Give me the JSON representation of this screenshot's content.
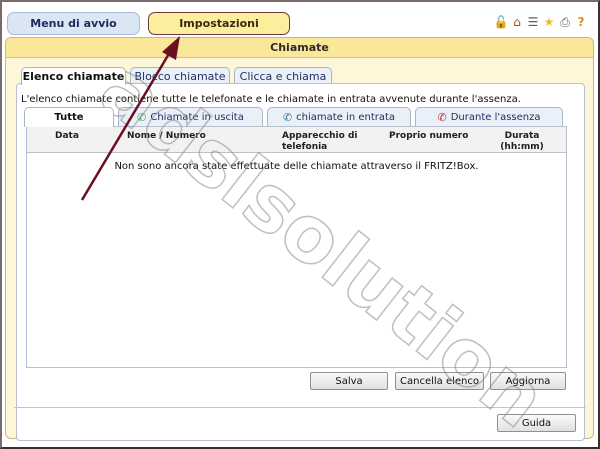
{
  "nav": {
    "start_menu_label": "Menu di avvio",
    "settings_label": "Impostazioni"
  },
  "toolbar_icons": [
    "lock-icon",
    "home-icon",
    "sitemap-icon",
    "star-icon",
    "print-icon",
    "help-icon"
  ],
  "panel": {
    "title": "Chiamate"
  },
  "tabs": [
    {
      "label": "Elenco chiamate",
      "active": true
    },
    {
      "label": "Blocco chiamate",
      "active": false
    },
    {
      "label": "Clicca e chiama",
      "active": false
    }
  ],
  "description": "L'elenco chiamate contiene tutte le telefonate e le chiamate in entrata avvenute durante l'assenza.",
  "subtabs": [
    {
      "label": "Tutte",
      "active": true,
      "icon": ""
    },
    {
      "label": "Chiamate in uscita",
      "active": false,
      "icon": "outgoing-call-icon"
    },
    {
      "label": "chiamate in entrata",
      "active": false,
      "icon": "incoming-call-icon"
    },
    {
      "label": "Durante l'assenza",
      "active": false,
      "icon": "missed-call-icon"
    }
  ],
  "table": {
    "columns": [
      {
        "label": "Data"
      },
      {
        "label": "Nome / Numero"
      },
      {
        "label": "Apparecchio di telefonia"
      },
      {
        "label": "Proprio numero"
      },
      {
        "label": "Durata (hh:mm)"
      }
    ],
    "empty_message": "Non sono ancora state effettuate delle chiamate attraverso il FRITZ!Box."
  },
  "buttons": {
    "save": "Salva",
    "clear_list": "Cancella elenco",
    "refresh": "Aggiorna",
    "help": "Guida"
  },
  "watermark": "adslsolution",
  "colors": {
    "panel_bg": "#fdf6d8",
    "title_bar": "#fbe79a",
    "settings_button": "#fbef9e",
    "start_button": "#dbe6f4",
    "arrow": "#6a1020"
  }
}
